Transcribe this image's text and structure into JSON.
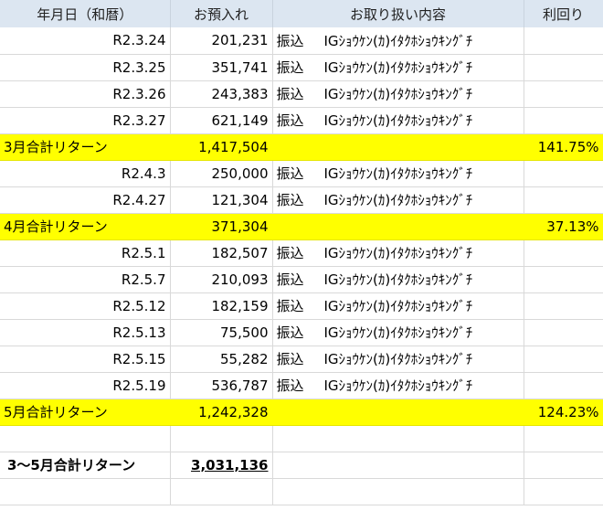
{
  "headers": [
    "年月日（和暦）",
    "お預入れ",
    "お取り扱い内容",
    "利回り"
  ],
  "rows": [
    {
      "date": "R2.3.24",
      "amount": "201,231",
      "kind": "振込",
      "detail": "IGｼｮｳｹﾝ(ｶ)ｲﾀｸﾎｼｮｳｷﾝｸﾞﾁ"
    },
    {
      "date": "R2.3.25",
      "amount": "351,741",
      "kind": "振込",
      "detail": "IGｼｮｳｹﾝ(ｶ)ｲﾀｸﾎｼｮｳｷﾝｸﾞﾁ"
    },
    {
      "date": "R2.3.26",
      "amount": "243,383",
      "kind": "振込",
      "detail": "IGｼｮｳｹﾝ(ｶ)ｲﾀｸﾎｼｮｳｷﾝｸﾞﾁ"
    },
    {
      "date": "R2.3.27",
      "amount": "621,149",
      "kind": "振込",
      "detail": "IGｼｮｳｹﾝ(ｶ)ｲﾀｸﾎｼｮｳｷﾝｸﾞﾁ"
    },
    {
      "summary": true,
      "label": "3月合計リターン",
      "amount": "1,417,504",
      "rate": "141.75%"
    },
    {
      "date": "R2.4.3",
      "amount": "250,000",
      "kind": "振込",
      "detail": "IGｼｮｳｹﾝ(ｶ)ｲﾀｸﾎｼｮｳｷﾝｸﾞﾁ"
    },
    {
      "date": "R2.4.27",
      "amount": "121,304",
      "kind": "振込",
      "detail": "IGｼｮｳｹﾝ(ｶ)ｲﾀｸﾎｼｮｳｷﾝｸﾞﾁ"
    },
    {
      "summary": true,
      "label": "4月合計リターン",
      "amount": "371,304",
      "rate": "37.13%"
    },
    {
      "date": "R2.5.1",
      "amount": "182,507",
      "kind": "振込",
      "detail": "IGｼｮｳｹﾝ(ｶ)ｲﾀｸﾎｼｮｳｷﾝｸﾞﾁ"
    },
    {
      "date": "R2.5.7",
      "amount": "210,093",
      "kind": "振込",
      "detail": "IGｼｮｳｹﾝ(ｶ)ｲﾀｸﾎｼｮｳｷﾝｸﾞﾁ"
    },
    {
      "date": "R2.5.12",
      "amount": "182,159",
      "kind": "振込",
      "detail": "IGｼｮｳｹﾝ(ｶ)ｲﾀｸﾎｼｮｳｷﾝｸﾞﾁ"
    },
    {
      "date": "R2.5.13",
      "amount": "75,500",
      "kind": "振込",
      "detail": "IGｼｮｳｹﾝ(ｶ)ｲﾀｸﾎｼｮｳｷﾝｸﾞﾁ"
    },
    {
      "date": "R2.5.15",
      "amount": "55,282",
      "kind": "振込",
      "detail": "IGｼｮｳｹﾝ(ｶ)ｲﾀｸﾎｼｮｳｷﾝｸﾞﾁ"
    },
    {
      "date": "R2.5.19",
      "amount": "536,787",
      "kind": "振込",
      "detail": "IGｼｮｳｹﾝ(ｶ)ｲﾀｸﾎｼｮｳｷﾝｸﾞﾁ"
    },
    {
      "summary": true,
      "label": "5月合計リターン",
      "amount": "1,242,328",
      "rate": "124.23%"
    },
    {
      "blank": true
    }
  ],
  "grand_total": {
    "label": "3～5月合計リターン",
    "amount": "3,031,136"
  },
  "colors": {
    "header_bg": "#dce6f1",
    "highlight": "#ffff00"
  }
}
